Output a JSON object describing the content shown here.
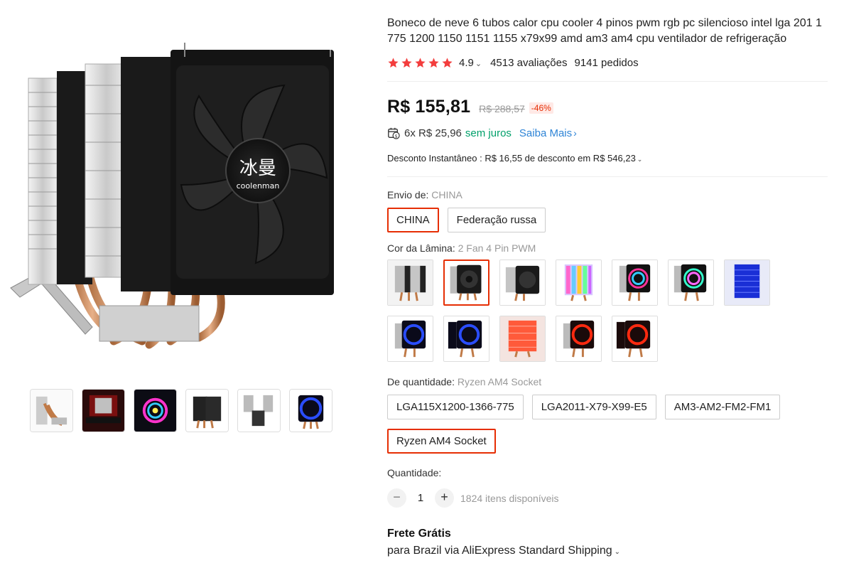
{
  "product": {
    "title": "Boneco de neve 6 tubos calor cpu cooler 4 pinos pwm rgb pc silencioso intel lga 201 1 775 1200 1150 1151 1155 x79x99 amd am3 am4 cpu ventilador de refrigeração",
    "rating": "4.9",
    "rating_stars": 5,
    "reviews": "4513 avaliações",
    "orders": "9141 pedidos",
    "logo_cn": "冰曼",
    "logo_en": "coolenman"
  },
  "pricing": {
    "price": "R$ 155,81",
    "old_price": "R$ 288,57",
    "discount": "-46%",
    "installments_text": "6x R$ 25,96",
    "interest_free": "sem juros",
    "learn_more": "Saiba Mais",
    "instant_discount": "Desconto Instantâneo : R$ 16,55 de desconto em R$ 546,23"
  },
  "ship_from": {
    "label": "Envio de: ",
    "selected": "CHINA",
    "options": [
      "CHINA",
      "Federação russa"
    ]
  },
  "color": {
    "label": "Cor da Lâmina: ",
    "selected": "2 Fan 4 Pin PWM",
    "selected_index": 1,
    "swatch_icons": [
      "cooler-silver-icon",
      "cooler-2fan-black-icon",
      "cooler-1fan-black-icon",
      "cooler-rgb-icon",
      "cooler-rgb-fan-icon",
      "cooler-rgb-2fan-icon",
      "cooler-blue-icon",
      "cooler-blue-1fan-icon",
      "cooler-blue-2fan-icon",
      "cooler-red-icon",
      "cooler-red-1fan-icon",
      "cooler-red-2fan-icon"
    ]
  },
  "quantity_type": {
    "label": "De quantidade: ",
    "selected": "Ryzen AM4 Socket",
    "options": [
      "LGA115X1200-1366-775",
      "LGA2011-X79-X99-E5",
      "AM3-AM2-FM2-FM1",
      "Ryzen AM4 Socket"
    ]
  },
  "quantity": {
    "label": "Quantidade:",
    "value": "1",
    "minus": "−",
    "plus": "+",
    "stock": "1824 itens disponíveis"
  },
  "shipping": {
    "title": "Frete Grátis",
    "desc": "para Brazil via AliExpress Standard Shipping"
  },
  "colors": {
    "accent": "#e62e04",
    "star": "#f33d3d",
    "green": "#00a06a",
    "link": "#2e84d6"
  }
}
